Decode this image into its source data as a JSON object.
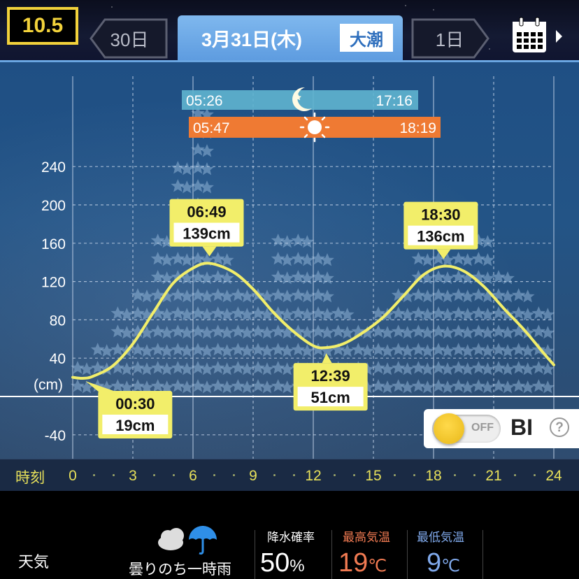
{
  "header": {
    "moon_age": "10.5",
    "prev_day": "30日",
    "date": "3月31日(木)",
    "tide_type": "大潮",
    "next_day": "1日"
  },
  "celestial": {
    "moonrise": "05:26",
    "moonset": "17:16",
    "sunrise": "05:47",
    "sunset": "18:19"
  },
  "chart_data": {
    "type": "line",
    "ylabel": "(cm)",
    "xlabel": "時刻",
    "ylim": [
      -60,
      270
    ],
    "xlim": [
      0,
      24
    ],
    "y_ticks": [
      "240",
      "200",
      "160",
      "120",
      "80",
      "40",
      "-40"
    ],
    "x_ticks": [
      "0",
      "3",
      "6",
      "9",
      "12",
      "15",
      "18",
      "21",
      "24"
    ],
    "grid": true,
    "series": [
      {
        "x": [
          0,
          0.5,
          1,
          2,
          3,
          4,
          5,
          6,
          6.82,
          8,
          9,
          10,
          11,
          12,
          12.65,
          13.5,
          14.5,
          15.5,
          16.5,
          17.5,
          18.5,
          19.5,
          20.5,
          21.5,
          22.5,
          23.5,
          24
        ],
        "y": [
          20,
          19,
          21,
          32,
          55,
          87,
          118,
          134,
          139,
          130,
          112,
          88,
          68,
          53,
          51,
          55,
          67,
          83,
          105,
          127,
          136,
          131,
          115,
          92,
          70,
          45,
          33
        ]
      }
    ],
    "annotations": [
      {
        "time": "00:30",
        "height": "19cm",
        "x": 0.5,
        "y": 19,
        "kind": "low"
      },
      {
        "time": "06:49",
        "height": "139cm",
        "x": 6.82,
        "y": 139,
        "kind": "high"
      },
      {
        "time": "12:39",
        "height": "51cm",
        "x": 12.65,
        "y": 51,
        "kind": "low"
      },
      {
        "time": "18:30",
        "height": "136cm",
        "x": 18.5,
        "y": 136,
        "kind": "high"
      }
    ],
    "colors": {
      "line": "#f2ee6a",
      "bubble": "#f2ee6a"
    },
    "catch_index_columns": [
      2,
      3,
      5,
      6,
      9,
      13,
      16,
      10,
      6,
      6,
      9,
      9,
      8,
      5,
      4,
      5,
      6,
      8,
      10,
      8,
      9,
      7,
      6,
      5
    ]
  },
  "time_axis": {
    "label": "時刻"
  },
  "bi": {
    "toggle": "OFF",
    "label": "BI",
    "help": "?"
  },
  "weather": {
    "label": "天気",
    "description": "曇りのち一時雨",
    "icons": [
      "cloud-icon",
      "umbrella-icon"
    ],
    "precip_label": "降水確率",
    "precip_value": "50",
    "precip_unit": "%",
    "high_label": "最高気温",
    "high_value": "19",
    "high_unit": "℃",
    "high_color": "#f07a52",
    "low_label": "最低気温",
    "low_value": "9",
    "low_unit": "℃",
    "low_color": "#7fa8ea"
  }
}
